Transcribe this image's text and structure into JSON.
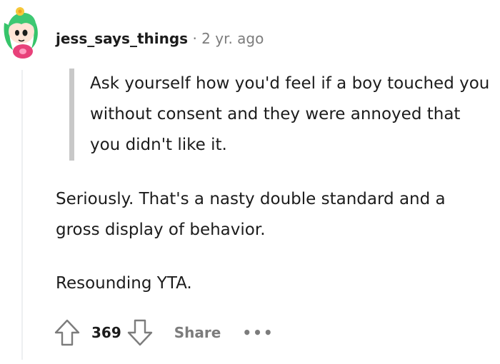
{
  "comment": {
    "username": "jess_says_things",
    "separator": "·",
    "timestamp": "2 yr. ago",
    "quote": "Ask yourself how you'd feel if a boy touched you without consent and they were annoyed that you didn't like it.",
    "paragraphs": [
      "Seriously. That's a nasty double standard and a gross display of behavior.",
      "Resounding YTA."
    ],
    "score": "369",
    "share_label": "Share",
    "more_label": "•••"
  },
  "icons": {
    "upvote": "arrow-up-icon",
    "downvote": "arrow-down-icon",
    "more": "more-options-icon"
  }
}
